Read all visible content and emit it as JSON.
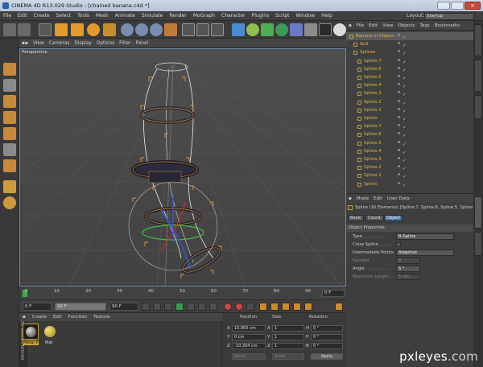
{
  "title": "CINEMA 4D R13.029 Studio - [chained banana.c4d *]",
  "menu": [
    "File",
    "Edit",
    "Create",
    "Select",
    "Tools",
    "Mesh",
    "Animate",
    "Simulate",
    "Render",
    "MoGraph",
    "Character",
    "Plugins",
    "Script",
    "Window",
    "Help"
  ],
  "layout": {
    "label": "Layout:",
    "value": "Startup"
  },
  "viewport": {
    "menu": [
      "View",
      "Cameras",
      "Display",
      "Options",
      "Filter",
      "Panel"
    ],
    "label": "Perspective"
  },
  "timeline": {
    "ticks": [
      "0",
      "10",
      "20",
      "30",
      "40",
      "50",
      "60",
      "70",
      "80",
      "90"
    ],
    "end_field": "0 F",
    "start_field": "0 F",
    "min_field": "0 F",
    "max_field": "90 F",
    "range_label": "90 F"
  },
  "material_manager": {
    "menu": [
      "Create",
      "Edit",
      "Function",
      "Texture"
    ],
    "materials": [
      "Metal P",
      "Mat"
    ]
  },
  "brand": {
    "line1": "MAXON",
    "line2": "CINEMA 4D"
  },
  "coordinates": {
    "headers": [
      "Position",
      "Size",
      "Rotation"
    ],
    "rows": [
      {
        "axis": "X",
        "pos": "10.865 cm",
        "saxis": "X",
        "size": "1",
        "raxis": "H",
        "rot": "0 °"
      },
      {
        "axis": "Y",
        "pos": "0 cm",
        "saxis": "Y",
        "size": "1",
        "raxis": "P",
        "rot": "0 °"
      },
      {
        "axis": "Z",
        "pos": "-10.304 cm",
        "saxis": "Z",
        "size": "1",
        "raxis": "B",
        "rot": "0 °"
      }
    ],
    "mode1": "World",
    "mode2": "Scale",
    "apply": "Apply"
  },
  "object_manager": {
    "menu": [
      "File",
      "Edit",
      "View",
      "Objects",
      "Tags",
      "Bookmarks"
    ],
    "items": [
      {
        "name": "Banana In Chains",
        "indent": 0
      },
      {
        "name": "Null",
        "indent": 1
      },
      {
        "name": "Splines",
        "indent": 1
      },
      {
        "name": "Spline.7",
        "indent": 2
      },
      {
        "name": "Spline.6",
        "indent": 2
      },
      {
        "name": "Spline.5",
        "indent": 2
      },
      {
        "name": "Spline.4",
        "indent": 2
      },
      {
        "name": "Spline.3",
        "indent": 2
      },
      {
        "name": "Spline.2",
        "indent": 2
      },
      {
        "name": "Spline.1",
        "indent": 2
      },
      {
        "name": "Spline",
        "indent": 2
      },
      {
        "name": "Spline.7",
        "indent": 2
      },
      {
        "name": "Spline.6",
        "indent": 2
      },
      {
        "name": "Spline.5",
        "indent": 2
      },
      {
        "name": "Spline.4",
        "indent": 2
      },
      {
        "name": "Spline.3",
        "indent": 2
      },
      {
        "name": "Spline.2",
        "indent": 2
      },
      {
        "name": "Spline.1",
        "indent": 2
      },
      {
        "name": "Spline",
        "indent": 2
      }
    ]
  },
  "attributes": {
    "menu": [
      "Mode",
      "Edit",
      "User Data"
    ],
    "header": "Spline (16 Elements) [Spline.7, Spline.6, Spline.5, Spline...",
    "tabs": [
      "Basic",
      "Coord.",
      "Object"
    ],
    "section": "Object Properties",
    "props": [
      {
        "label": "Type . . . . . . . . .",
        "value": "B-Spline",
        "dim": false
      },
      {
        "label": "Close Spline . . . . .",
        "value": "",
        "dim": false
      },
      {
        "label": "Intermediate Points",
        "value": "Adaptive",
        "dim": false
      },
      {
        "label": "Number . . . . . . . .",
        "value": "8",
        "dim": true
      },
      {
        "label": "Angle . . . . . . . . .",
        "value": "5 °",
        "dim": false
      },
      {
        "label": "Maximum Length . .",
        "value": "5 cm",
        "dim": true
      }
    ]
  },
  "watermark": {
    "brand": "pxleyes",
    "domain": ".com"
  }
}
